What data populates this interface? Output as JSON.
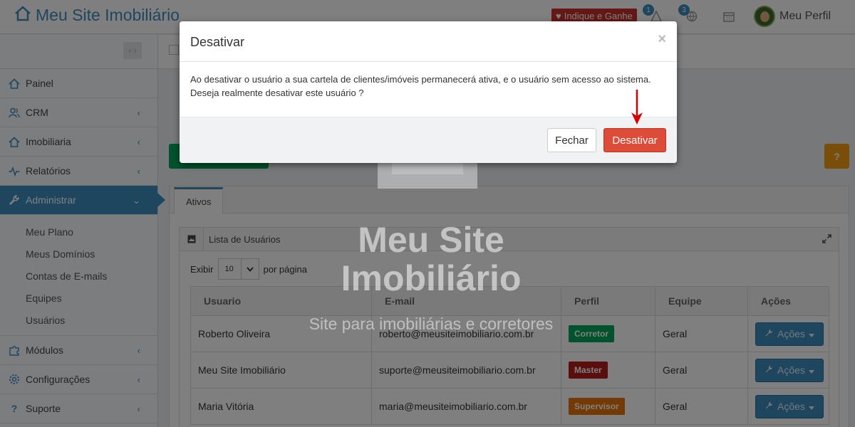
{
  "header": {
    "brand": "Meu Site Imobiliário",
    "indique": "Indique e Ganhe",
    "alerts_badge": "1",
    "globe_badge": "3",
    "profile": "Meu Perfil"
  },
  "sidebar": {
    "items": [
      {
        "label": "Painel"
      },
      {
        "label": "CRM"
      },
      {
        "label": "Imobiliaria"
      },
      {
        "label": "Relatórios"
      },
      {
        "label": "Administrar"
      }
    ],
    "subitems": [
      "Meu Plano",
      "Meus Domínios",
      "Contas de E-mails",
      "Equipes",
      "Usuários"
    ],
    "bottom": [
      {
        "label": "Módulos"
      },
      {
        "label": "Configurações"
      },
      {
        "label": "Suporte"
      }
    ]
  },
  "main": {
    "help": "?",
    "tab": "Ativos",
    "panel_title": "Lista de Usuários",
    "length_prefix": "Exibir",
    "length_value": "10",
    "length_suffix": "por página",
    "columns": [
      "Usuario",
      "E-mail",
      "Perfil",
      "Equipe",
      "Ações"
    ],
    "rows": [
      {
        "usuario": "Roberto Oliveira",
        "email": "roberto@meusiteimobiliario.com.br",
        "perfil": "Corretor",
        "equipe": "Geral",
        "acoes": "Ações"
      },
      {
        "usuario": "Meu Site Imobiliário",
        "email": "suporte@meusiteimobiliario.com.br",
        "perfil": "Master",
        "equipe": "Geral",
        "acoes": "Ações"
      },
      {
        "usuario": "Maria Vitória",
        "email": "maria@meusiteimobiliario.com.br",
        "perfil": "Supervisor",
        "equipe": "Geral",
        "acoes": "Ações"
      }
    ],
    "perfil_colors": {
      "Corretor": "#00a65a",
      "Master": "#b71c1c",
      "Supervisor": "#e8740c"
    }
  },
  "watermark": {
    "line1": "Meu Site",
    "line2": "Imobiliário",
    "sub": "Site para imobiliárias e corretores"
  },
  "modal": {
    "title": "Desativar",
    "close": "×",
    "body_line1": "Ao desativar o usuário a sua cartela de clientes/imóveis permanecerá ativa, e o usuário sem acesso ao sistema.",
    "body_line2": "Deseja realmente desativar este usuário ?",
    "cancel": "Fechar",
    "confirm": "Desativar"
  },
  "colors": {
    "accent": "#3c8dbc",
    "danger": "#dd4b39"
  }
}
